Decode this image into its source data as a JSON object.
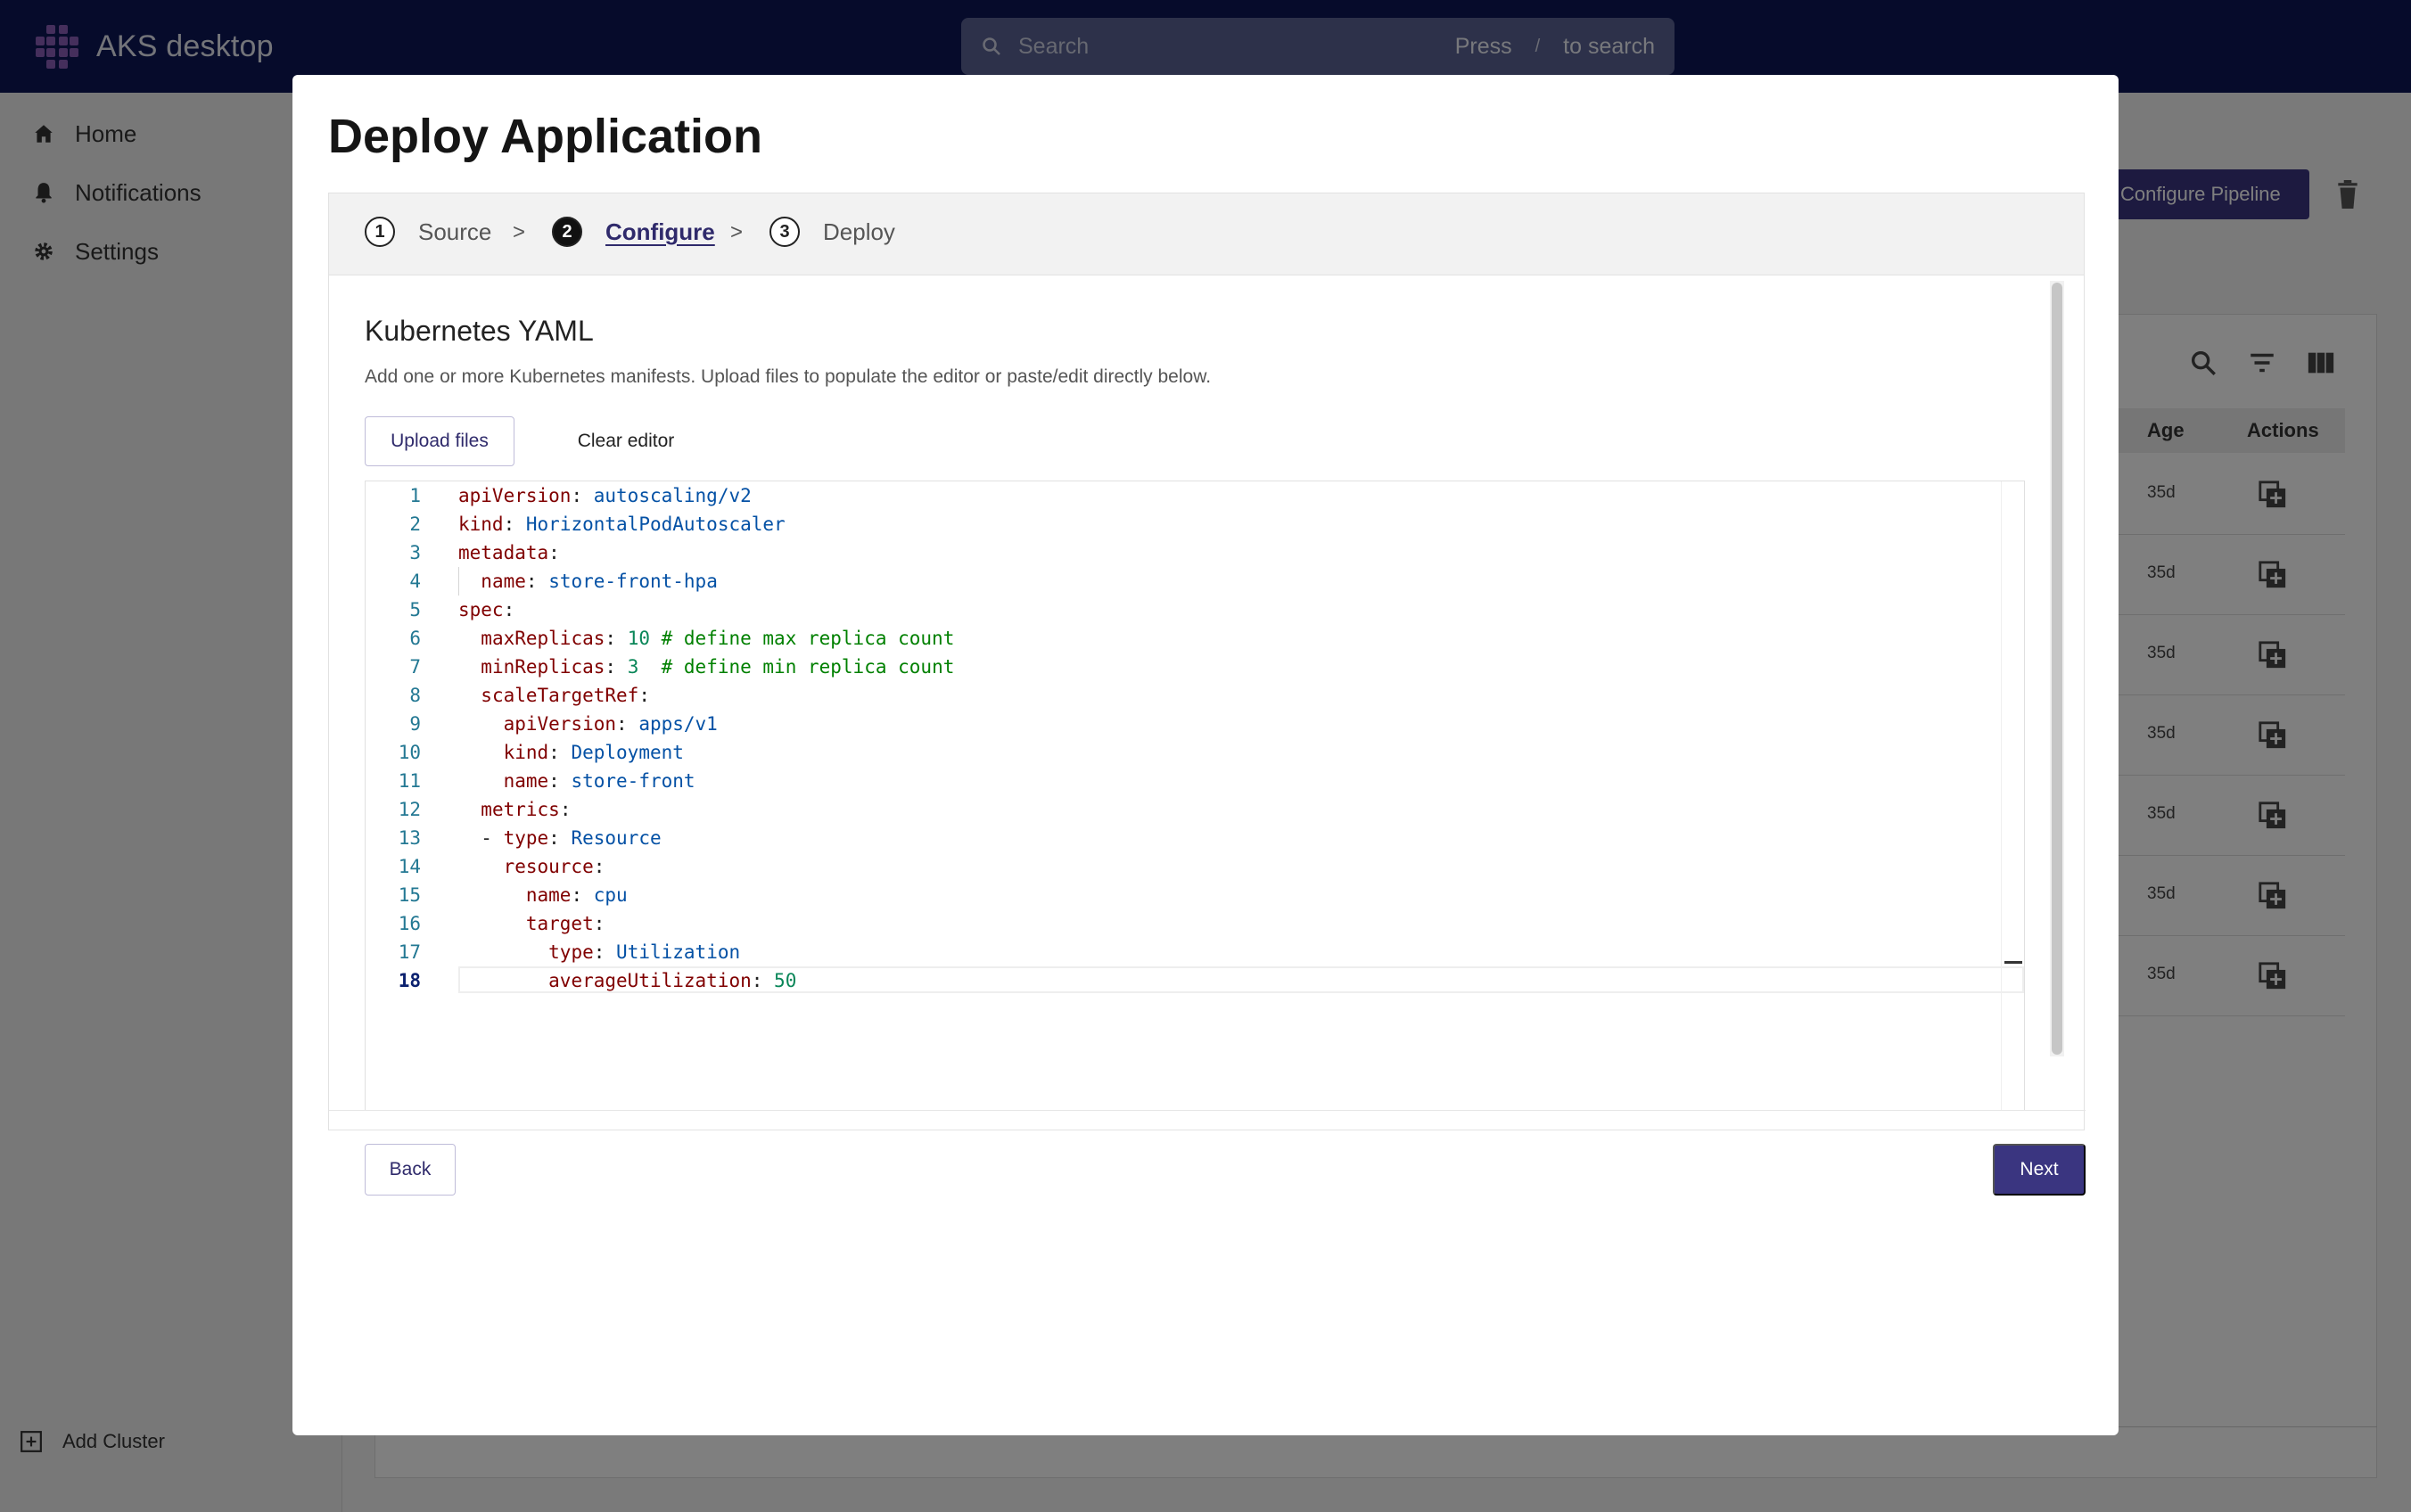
{
  "app": {
    "title": "AKS desktop",
    "search_placeholder": "Search",
    "search_hint_press": "Press",
    "search_hint_key": "/",
    "search_hint_suffix": "to search"
  },
  "sidebar": {
    "items": [
      {
        "label": "Home",
        "icon": "home-icon"
      },
      {
        "label": "Notifications",
        "icon": "bell-icon"
      },
      {
        "label": "Settings",
        "icon": "gear-icon"
      }
    ],
    "add_cluster": "Add Cluster"
  },
  "background": {
    "configure_pipeline": "Configure Pipeline",
    "columns": {
      "age": "Age",
      "actions": "Actions"
    },
    "rows": [
      "35d",
      "35d",
      "35d",
      "35d",
      "35d",
      "35d",
      "35d"
    ]
  },
  "modal": {
    "title": "Deploy Application",
    "steps": [
      {
        "num": "1",
        "label": "Source"
      },
      {
        "num": "2",
        "label": "Configure"
      },
      {
        "num": "3",
        "label": "Deploy"
      }
    ],
    "separator": ">",
    "panel": {
      "title": "Kubernetes YAML",
      "description": "Add one or more Kubernetes manifests. Upload files to populate the editor or paste/edit directly below.",
      "upload_button": "Upload files",
      "clear_button": "Clear editor"
    },
    "editor": {
      "current_line": 18,
      "lines": [
        {
          "n": "1",
          "indent": "",
          "dash": "",
          "key": "apiVersion",
          "val": "autoscaling/v2",
          "num": "",
          "comment": ""
        },
        {
          "n": "2",
          "indent": "",
          "dash": "",
          "key": "kind",
          "val": "HorizontalPodAutoscaler",
          "num": "",
          "comment": ""
        },
        {
          "n": "3",
          "indent": "",
          "dash": "",
          "key": "metadata",
          "val": "",
          "num": "",
          "comment": ""
        },
        {
          "n": "4",
          "indent": "  ",
          "dash": "",
          "key": "name",
          "val": "store-front-hpa",
          "num": "",
          "comment": ""
        },
        {
          "n": "5",
          "indent": "",
          "dash": "",
          "key": "spec",
          "val": "",
          "num": "",
          "comment": ""
        },
        {
          "n": "6",
          "indent": "  ",
          "dash": "",
          "key": "maxReplicas",
          "val": "",
          "num": "10",
          "comment": " # define max replica count"
        },
        {
          "n": "7",
          "indent": "  ",
          "dash": "",
          "key": "minReplicas",
          "val": "",
          "num": "3",
          "comment": "  # define min replica count"
        },
        {
          "n": "8",
          "indent": "  ",
          "dash": "",
          "key": "scaleTargetRef",
          "val": "",
          "num": "",
          "comment": ""
        },
        {
          "n": "9",
          "indent": "    ",
          "dash": "",
          "key": "apiVersion",
          "val": "apps/v1",
          "num": "",
          "comment": ""
        },
        {
          "n": "10",
          "indent": "    ",
          "dash": "",
          "key": "kind",
          "val": "Deployment",
          "num": "",
          "comment": ""
        },
        {
          "n": "11",
          "indent": "    ",
          "dash": "",
          "key": "name",
          "val": "store-front",
          "num": "",
          "comment": ""
        },
        {
          "n": "12",
          "indent": "  ",
          "dash": "",
          "key": "metrics",
          "val": "",
          "num": "",
          "comment": ""
        },
        {
          "n": "13",
          "indent": "  ",
          "dash": "- ",
          "key": "type",
          "val": "Resource",
          "num": "",
          "comment": ""
        },
        {
          "n": "14",
          "indent": "    ",
          "dash": "",
          "key": "resource",
          "val": "",
          "num": "",
          "comment": ""
        },
        {
          "n": "15",
          "indent": "      ",
          "dash": "",
          "key": "name",
          "val": "cpu",
          "num": "",
          "comment": ""
        },
        {
          "n": "16",
          "indent": "      ",
          "dash": "",
          "key": "target",
          "val": "",
          "num": "",
          "comment": ""
        },
        {
          "n": "17",
          "indent": "        ",
          "dash": "",
          "key": "type",
          "val": "Utilization",
          "num": "",
          "comment": ""
        },
        {
          "n": "18",
          "indent": "        ",
          "dash": "",
          "key": "averageUtilization",
          "val": "",
          "num": "50",
          "comment": ""
        }
      ]
    },
    "back_button": "Back",
    "next_button": "Next"
  },
  "colors": {
    "appbar": "#0c1657",
    "primary": "#3a3580",
    "yaml_key": "#800000",
    "yaml_value": "#0451a5",
    "yaml_number": "#098658",
    "yaml_comment": "#008000"
  }
}
